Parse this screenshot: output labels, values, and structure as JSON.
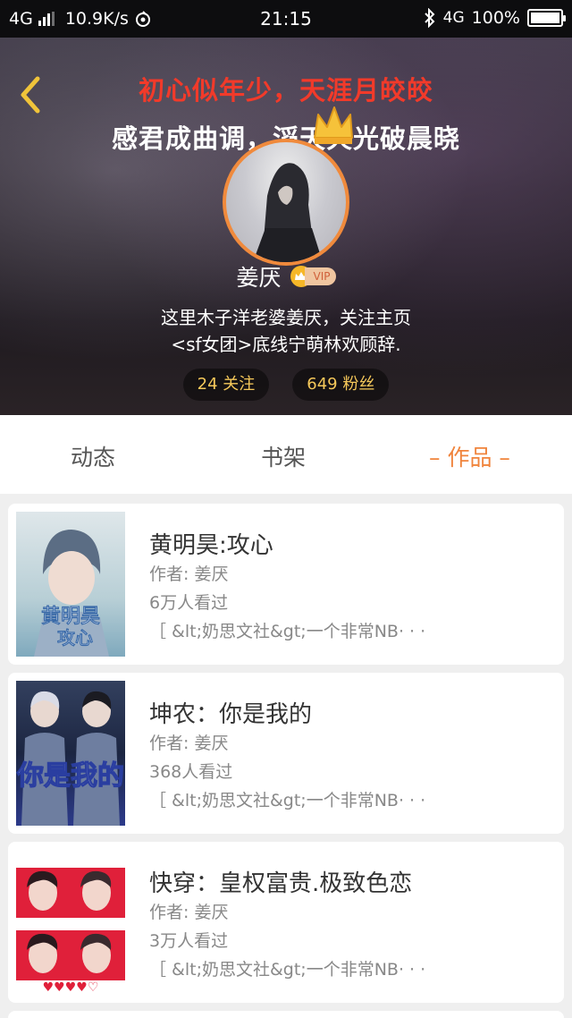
{
  "status_bar": {
    "network": "4G",
    "speed": "10.9K/s",
    "time": "21:15",
    "network_right": "4G",
    "battery": "100%"
  },
  "header": {
    "banner_line_1": "初心似年少，天涯月皎皎",
    "banner_line_2": "感君成曲调，滔天火光破晨晓",
    "username": "姜厌",
    "vip_label": "VIP",
    "bio_line_1": "这里木子洋老婆姜厌，关注主页",
    "bio_line_2": "<sf女团>底线宁萌林欢顾辞.",
    "following": "24 关注",
    "followers": "649 粉丝",
    "accent_color": "#f0843c",
    "banner_color": "#f23a2a"
  },
  "tabs": {
    "items": [
      {
        "label": "动态"
      },
      {
        "label": "书架"
      },
      {
        "label": "– 作品 –"
      }
    ],
    "active_index": 2
  },
  "books": [
    {
      "title": "黄明昊:攻心",
      "author": "作者: 姜厌",
      "views": "6万人看过",
      "intro": "［ &lt;奶思文社&gt;一个非常NB· · ·",
      "cover_text": "黄明昊 攻心"
    },
    {
      "title": "坤农：你是我的",
      "author": "作者: 姜厌",
      "views": "368人看过",
      "intro": "［ &lt;奶思文社&gt;一个非常NB· · ·",
      "cover_text": "你是我的"
    },
    {
      "title": "快穿：皇权富贵.极致色恋",
      "author": "作者: 姜厌",
      "views": "3万人看过",
      "intro": "［ &lt;奶思文社&gt;一个非常NB· · ·",
      "cover_text": "♥♥♥♥♡"
    }
  ]
}
